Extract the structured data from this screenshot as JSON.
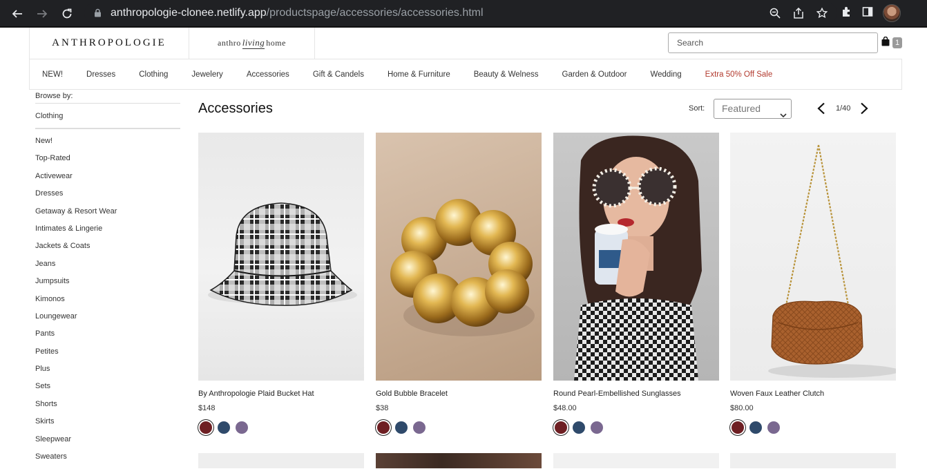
{
  "browser": {
    "url_host": "anthropologie-clonee.netlify.app",
    "url_path": "/productspage/accessories/accessories.html"
  },
  "header": {
    "logo": "ANTHROPOLOGIE",
    "living_pre": "anthro",
    "living_script": "living",
    "living_post": "home",
    "search_placeholder": "Search",
    "cart_count": "1"
  },
  "nav": {
    "items": [
      "NEW!",
      "Dresses",
      "Clothing",
      "Jewelery",
      "Accessories",
      "Gift & Candels",
      "Home & Furniture",
      "Beauty & Welness",
      "Garden & Outdoor",
      "Wedding"
    ],
    "sale": "Extra 50% Off Sale",
    "sale_color": "#b23a2e"
  },
  "sidebar": {
    "browse_by": "Browse by:",
    "section": "Clothing",
    "items": [
      "New!",
      "Top-Rated",
      "Activewear",
      "Dresses",
      "Getaway & Resort Wear",
      "Intimates & Lingerie",
      "Jackets & Coats",
      "Jeans",
      "Jumpsuits",
      "Kimonos",
      "Loungewear",
      "Pants",
      "Petites",
      "Plus",
      "Sets",
      "Shorts",
      "Skirts",
      "Sleepwear",
      "Sweaters"
    ]
  },
  "main": {
    "title": "Accessories",
    "sort_label": "Sort:",
    "sort_value": "Featured",
    "page": "1/40"
  },
  "products": [
    {
      "name": "By Anthropologie Plaid Bucket Hat",
      "price": "$148"
    },
    {
      "name": "Gold Bubble Bracelet",
      "price": "$38"
    },
    {
      "name": "Round Pearl-Embellished Sunglasses",
      "price": "$48.00"
    },
    {
      "name": "Woven Faux Leather Clutch",
      "price": "$80.00"
    }
  ],
  "swatch_colors": [
    "#6e1f23",
    "#2f4a6b",
    "#7a6890"
  ]
}
